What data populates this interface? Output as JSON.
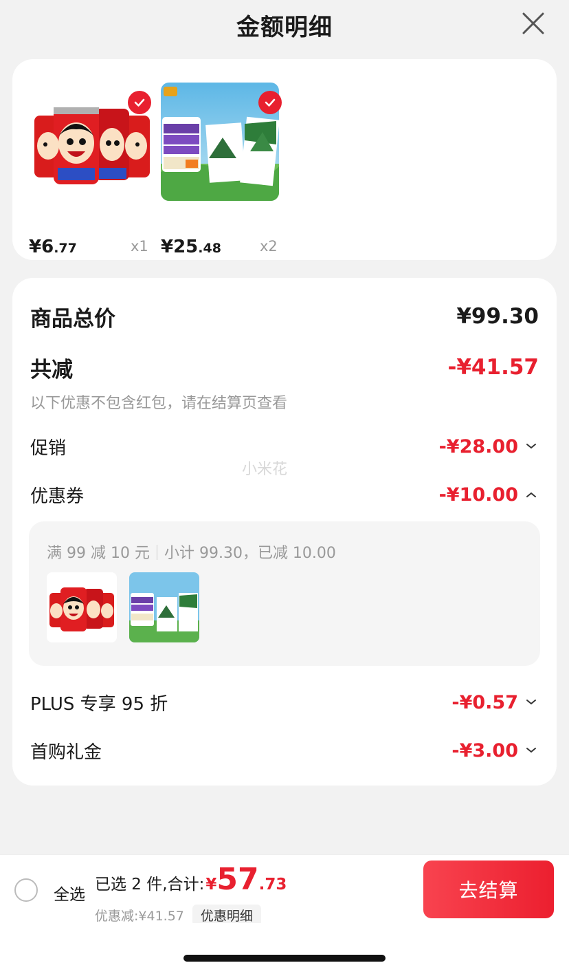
{
  "header": {
    "title": "金额明细"
  },
  "products": [
    {
      "price_int": "¥6",
      "price_dec": ".77",
      "qty": "x1",
      "image": "wangzai-milk-cans"
    },
    {
      "price_int": "¥25",
      "price_dec": ".48",
      "qty": "x2",
      "image": "pure-milk-box"
    }
  ],
  "summary": {
    "total_label": "商品总价",
    "total_value": "¥99.30",
    "reduce_label": "共减",
    "reduce_value": "-¥41.57",
    "reduce_note": "以下优惠不包含红包，请在结算页查看",
    "promo_label": "促销",
    "promo_value": "-¥28.00",
    "coupon_label": "优惠券",
    "coupon_value": "-¥10.00",
    "coupon_rule": "满 99 减 10 元",
    "coupon_subtotal": "小计 99.30，已减 10.00",
    "plus_label": "PLUS 专享 95 折",
    "plus_value": "-¥0.57",
    "gift_label": "首购礼金",
    "gift_value": "-¥3.00"
  },
  "watermark": "小米花",
  "bottom": {
    "select_all": "全选",
    "selected_text": "已选 2 件,合计:",
    "currency": "¥",
    "total_int": "57",
    "total_dec": ".73",
    "discount_text": "优惠减:¥41.57",
    "detail_label": "优惠明细",
    "checkout_label": "去结算"
  },
  "colors": {
    "accent": "#e8202f",
    "muted": "#999999",
    "background": "#f2f2f2"
  }
}
